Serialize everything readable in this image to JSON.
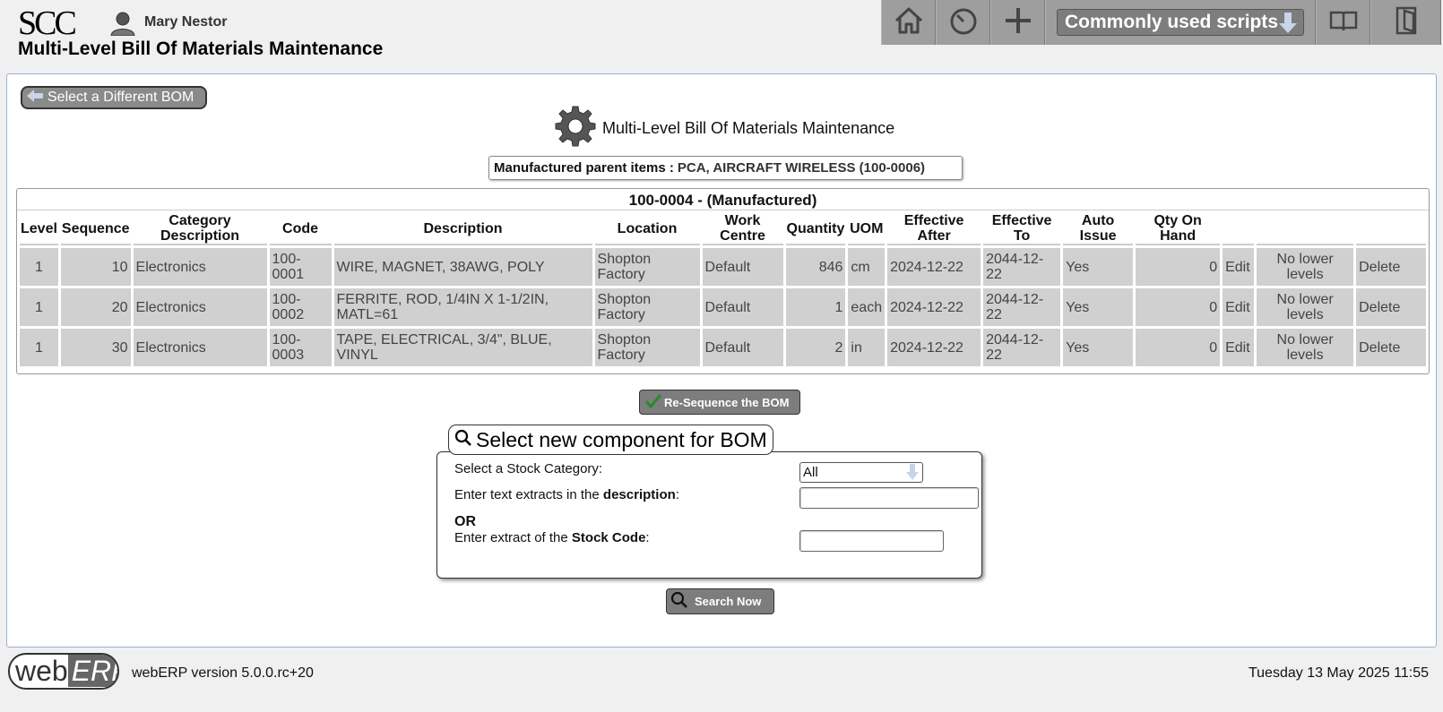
{
  "header": {
    "logo": "SCC",
    "user_name": "Mary Nestor",
    "page_title": "Multi-Level Bill Of Materials Maintenance",
    "scripts_label": "Commonly used scripts"
  },
  "main": {
    "back_label": "Select a Different BOM",
    "section_title": "Multi-Level Bill Of Materials Maintenance",
    "parent_label": "Manufactured parent items :",
    "parent_value": "PCA, AIRCRAFT WIRELESS (100-0006)",
    "bom_caption": "100-0004 - (Manufactured)",
    "columns": [
      "Level",
      "Sequence",
      "Category Description",
      "Code",
      "Description",
      "Location",
      "Work Centre",
      "Quantity",
      "UOM",
      "Effective After",
      "Effective To",
      "Auto Issue",
      "Qty On Hand"
    ],
    "rows": [
      {
        "level": "1",
        "sequence": "10",
        "category": "Electronics",
        "code": "100-0001",
        "description": "WIRE, MAGNET, 38AWG, POLY",
        "location": "Shopton Factory",
        "work_centre": "Default",
        "quantity": "846",
        "uom": "cm",
        "eff_after": "2024-12-22",
        "eff_to": "2044-12-22",
        "auto_issue": "Yes",
        "qoh": "0",
        "edit": "Edit",
        "lower": "No lower levels",
        "delete": "Delete"
      },
      {
        "level": "1",
        "sequence": "20",
        "category": "Electronics",
        "code": "100-0002",
        "description": "FERRITE, ROD, 1/4IN X 1-1/2IN, MATL=61",
        "location": "Shopton Factory",
        "work_centre": "Default",
        "quantity": "1",
        "uom": "each",
        "eff_after": "2024-12-22",
        "eff_to": "2044-12-22",
        "auto_issue": "Yes",
        "qoh": "0",
        "edit": "Edit",
        "lower": "No lower levels",
        "delete": "Delete"
      },
      {
        "level": "1",
        "sequence": "30",
        "category": "Electronics",
        "code": "100-0003",
        "description": "TAPE, ELECTRICAL, 3/4\", BLUE, VINYL",
        "location": "Shopton Factory",
        "work_centre": "Default",
        "quantity": "2",
        "uom": "in",
        "eff_after": "2024-12-22",
        "eff_to": "2044-12-22",
        "auto_issue": "Yes",
        "qoh": "0",
        "edit": "Edit",
        "lower": "No lower levels",
        "delete": "Delete"
      }
    ],
    "resequence_label": "Re-Sequence the BOM"
  },
  "search": {
    "legend": "Select new component for BOM",
    "category_label": "Select a Stock Category:",
    "category_value": "All",
    "desc_label_pre": "Enter text extracts in the",
    "desc_label_bold": "description",
    "desc_label_post": ":",
    "or_label": "OR",
    "code_label_pre": "Enter extract of the",
    "code_label_bold": "Stock Code",
    "code_label_post": ":",
    "desc_value": "",
    "code_value": "",
    "search_label": "Search Now"
  },
  "footer": {
    "logo_web": "web",
    "logo_erp": "ERP",
    "version": "webERP version 5.0.0.rc+20",
    "datetime": "Tuesday 13 May 2025 11:55"
  },
  "icons": [
    "user-icon",
    "home-icon",
    "dashboard-icon",
    "plus-icon",
    "arrow-down-icon",
    "manual-icon",
    "logout-icon",
    "back-arrow-icon",
    "gear-icon",
    "checkmark-icon",
    "search-icon"
  ]
}
